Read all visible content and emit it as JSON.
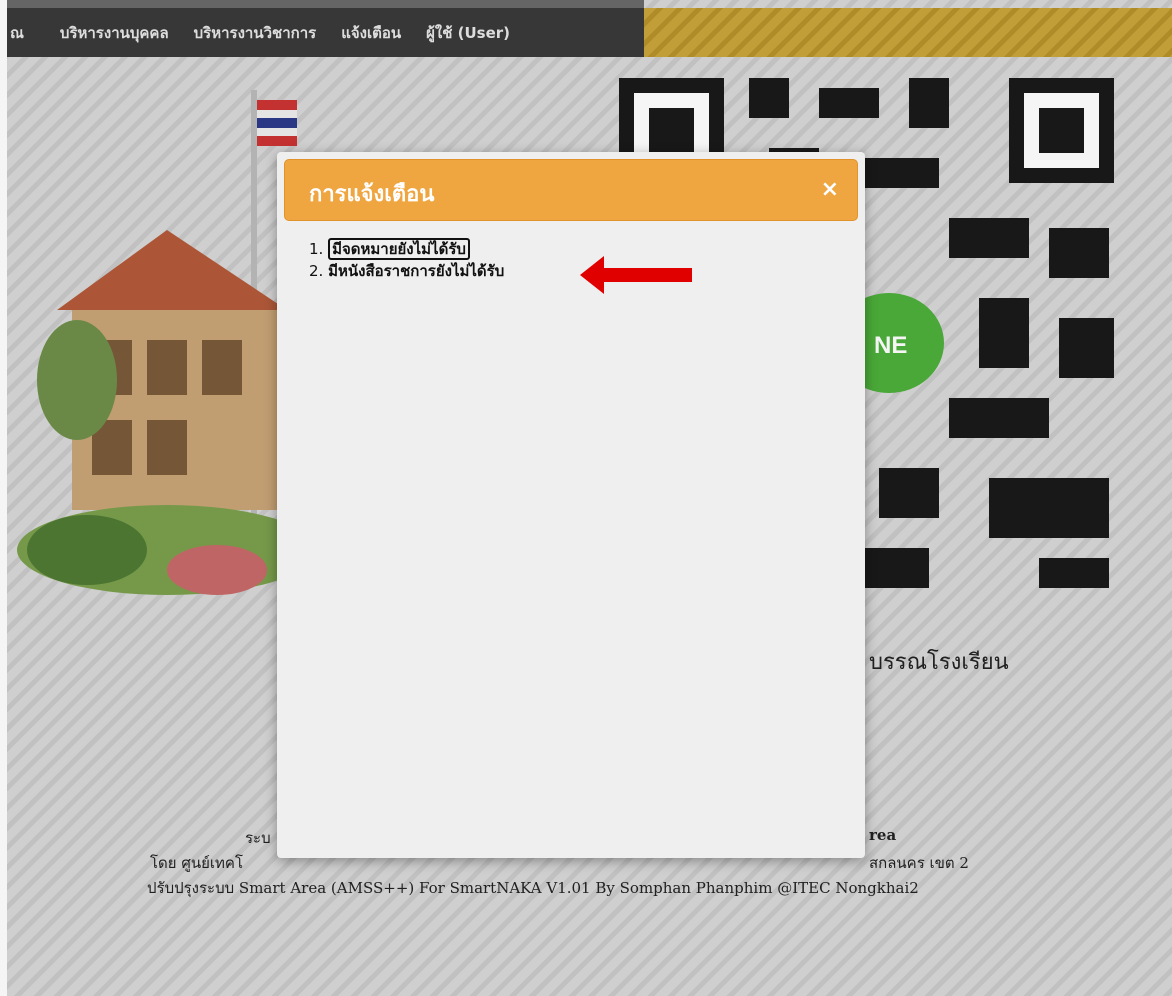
{
  "nav": {
    "items": [
      {
        "label": "ณ"
      },
      {
        "label": "บริหารงานบุคคล"
      },
      {
        "label": "บริหารงานวิชาการ"
      },
      {
        "label": "แจ้งเตือน"
      },
      {
        "label": "ผู้ใช้ (User)"
      }
    ]
  },
  "background": {
    "title_fragment": "บรรณโรงเรียน",
    "footer_line1_left": "ระบ",
    "footer_line1_right": "rea",
    "footer_line2_left": "โดย ศูนย์เทคโ",
    "footer_line2_right": "สกลนคร เขต 2",
    "footer_line3": "ปรับปรุงระบบ Smart Area (AMSS++) For SmartNAKA V1.01 By Somphan Phanphim @ITEC Nongkhai2",
    "qr_badge_text": "NE"
  },
  "modal": {
    "title": "การแจ้งเตือน",
    "close_label": "×",
    "items": [
      {
        "number": "1.",
        "text": "มีจดหมายยังไม่ได้รับ"
      },
      {
        "number": "2.",
        "text": "มีหนังสือราชการยังไม่ได้รับ"
      }
    ]
  },
  "colors": {
    "navbar": "#3a3a3a",
    "modal_header": "#f0a640",
    "annotation_arrow": "#e00000"
  }
}
